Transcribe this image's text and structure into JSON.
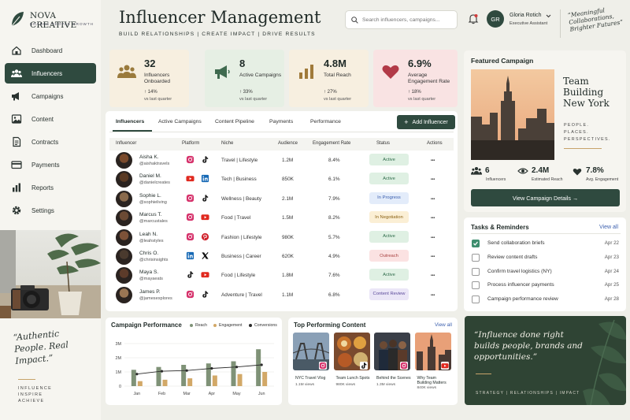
{
  "brand": {
    "name": "NOVA CREATIVE",
    "tagline": "BRANDS  PEOPLE  GROWTH"
  },
  "nav": [
    {
      "label": "Dashboard",
      "icon": "home-icon"
    },
    {
      "label": "Influencers",
      "icon": "users-icon",
      "active": true
    },
    {
      "label": "Campaigns",
      "icon": "megaphone-icon"
    },
    {
      "label": "Content",
      "icon": "image-icon"
    },
    {
      "label": "Contracts",
      "icon": "document-icon"
    },
    {
      "label": "Payments",
      "icon": "card-icon"
    },
    {
      "label": "Reports",
      "icon": "bar-chart-icon"
    },
    {
      "label": "Settings",
      "icon": "gear-icon"
    }
  ],
  "sidebar_quote": {
    "text": "“Authentic People. Real Impact.”",
    "footer": [
      "INFLUENCE",
      "INSPIRE",
      "ACHIEVE"
    ]
  },
  "header": {
    "title": "Influencer Management",
    "subtitle": "BUILD RELATIONSHIPS  |  CREATE IMPACT  |  DRIVE RESULTS",
    "search_placeholder": "Search influencers, campaigns...",
    "user": {
      "initials": "GR",
      "name": "Gloria Rotich",
      "role": "Executive Assistant"
    },
    "quote": "“Meaningful Collaborations, Brighter Futures”"
  },
  "kpis": [
    {
      "value": "32",
      "label": "Influencers Onboarded",
      "change": "14%",
      "period": "vs last quarter",
      "icon": "users-icon"
    },
    {
      "value": "8",
      "label": "Active Campaigns",
      "change": "33%",
      "period": "vs last quarter",
      "icon": "megaphone-icon"
    },
    {
      "value": "4.8M",
      "label": "Total Reach",
      "change": "27%",
      "period": "vs last quarter",
      "icon": "bar-chart-icon"
    },
    {
      "value": "6.9%",
      "label": "Average Engagement Rate",
      "change": "18%",
      "period": "vs last quarter",
      "icon": "heart-icon"
    }
  ],
  "tabs": [
    "Influencers",
    "Active Campaigns",
    "Content Pipeline",
    "Payments",
    "Performance"
  ],
  "add_button": "Add Influencer",
  "table": {
    "columns": [
      "Influencer",
      "Platform",
      "Niche",
      "Audience",
      "Engagement Rate",
      "Status",
      "Actions"
    ],
    "rows": [
      {
        "name": "Aisha K.",
        "handle": "@aishaktravels",
        "platforms": [
          "instagram",
          "tiktok"
        ],
        "niche": "Travel | Lifestyle",
        "audience": "1.2M",
        "er": "8.4%",
        "status": "Active",
        "tone": "active"
      },
      {
        "name": "Daniel M.",
        "handle": "@danielcreates",
        "platforms": [
          "youtube",
          "linkedin"
        ],
        "niche": "Tech | Business",
        "audience": "850K",
        "er": "6.1%",
        "status": "Active",
        "tone": "active"
      },
      {
        "name": "Sophie L.",
        "handle": "@sophieliving",
        "platforms": [
          "instagram",
          "tiktok"
        ],
        "niche": "Wellness | Beauty",
        "audience": "2.1M",
        "er": "7.9%",
        "status": "In Progress",
        "tone": "progress"
      },
      {
        "name": "Marcus T.",
        "handle": "@marcustales",
        "platforms": [
          "instagram",
          "youtube"
        ],
        "niche": "Food | Travel",
        "audience": "1.5M",
        "er": "8.2%",
        "status": "In Negotiation",
        "tone": "negotiation"
      },
      {
        "name": "Leah N.",
        "handle": "@leahstyles",
        "platforms": [
          "instagram",
          "pinterest"
        ],
        "niche": "Fashion | Lifestyle",
        "audience": "980K",
        "er": "5.7%",
        "status": "Active",
        "tone": "active"
      },
      {
        "name": "Chris O.",
        "handle": "@chrisinsights",
        "platforms": [
          "linkedin",
          "x"
        ],
        "niche": "Business | Career",
        "audience": "620K",
        "er": "4.9%",
        "status": "Outreach",
        "tone": "outreach"
      },
      {
        "name": "Maya S.",
        "handle": "@mayaeats",
        "platforms": [
          "tiktok",
          "youtube"
        ],
        "niche": "Food | Lifestyle",
        "audience": "1.8M",
        "er": "7.6%",
        "status": "Active",
        "tone": "active"
      },
      {
        "name": "James P.",
        "handle": "@jamesexplores",
        "platforms": [
          "instagram",
          "tiktok"
        ],
        "niche": "Adventure | Travel",
        "audience": "1.1M",
        "er": "6.8%",
        "status": "Content Review",
        "tone": "review"
      }
    ]
  },
  "featured": {
    "section_title": "Featured Campaign",
    "campaign_title": "Team Building New York",
    "tagline": "PEOPLE. PLACES. PERSPECTIVES.",
    "stats": [
      {
        "value": "6",
        "label": "Influencers",
        "icon": "users-icon"
      },
      {
        "value": "2.4M",
        "label": "Estimated Reach",
        "icon": "eye-icon"
      },
      {
        "value": "7.8%",
        "label": "Avg. Engagement",
        "icon": "heart-icon"
      }
    ],
    "button": "View Campaign Details →"
  },
  "tasks": {
    "title": "Tasks & Reminders",
    "view_all": "View all",
    "items": [
      {
        "text": "Send collaboration briefs",
        "date": "Apr 22",
        "done": true
      },
      {
        "text": "Review content drafts",
        "date": "Apr 23",
        "done": false
      },
      {
        "text": "Confirm travel logistics (NY)",
        "date": "Apr 24",
        "done": false
      },
      {
        "text": "Process influencer payments",
        "date": "Apr 25",
        "done": false
      },
      {
        "text": "Campaign performance review",
        "date": "Apr 28",
        "done": false
      }
    ]
  },
  "chart_data": {
    "type": "bar",
    "title": "Campaign Performance",
    "categories": [
      "Jan",
      "Feb",
      "Mar",
      "Apr",
      "May",
      "Jun"
    ],
    "ylim": [
      0,
      3
    ],
    "yticks": [
      "0",
      "1M",
      "2M",
      "3M"
    ],
    "series": [
      {
        "name": "Reach",
        "kind": "bar",
        "color": "#7f9277",
        "values": [
          1.15,
          1.35,
          1.5,
          1.6,
          1.75,
          2.6
        ]
      },
      {
        "name": "Engagement",
        "kind": "bar",
        "color": "#d2a867",
        "values": [
          0.35,
          0.45,
          0.55,
          0.75,
          0.85,
          1.0
        ]
      },
      {
        "name": "Conversions",
        "kind": "line",
        "color": "#2b2b2b",
        "values": [
          0.85,
          1.05,
          1.1,
          1.25,
          1.35,
          1.5
        ]
      }
    ],
    "grid": true,
    "legend": "top-right"
  },
  "top_content": {
    "title": "Top Performing Content",
    "view_all": "View all",
    "items": [
      {
        "title": "NYC Travel Vlog",
        "views": "1.1M views",
        "platform": "instagram"
      },
      {
        "title": "Team Lunch Spots",
        "views": "980K views",
        "platform": "tiktok"
      },
      {
        "title": "Behind the Scenes",
        "views": "1.3M views",
        "platform": "instagram"
      },
      {
        "title": "Why Team Building Matters",
        "views": "840K views",
        "platform": "youtube"
      }
    ]
  },
  "quote_card": {
    "text": "“Influence done right builds people, brands and opportunities.”",
    "footer": "STRATEGY  |  RELATIONSHIPS  |  IMPACT"
  },
  "colors": {
    "brand": "#2f4a3f",
    "active_bg": "#dff0e3",
    "active_fg": "#2e6b4a",
    "progress_bg": "#e3ecfa",
    "progress_fg": "#3b5fae",
    "negotiation_bg": "#fbefd5",
    "negotiation_fg": "#8a6214",
    "outreach_bg": "#fbe2e2",
    "outreach_fg": "#a8403f",
    "review_bg": "#ebe6f7",
    "review_fg": "#5b4a9a"
  }
}
